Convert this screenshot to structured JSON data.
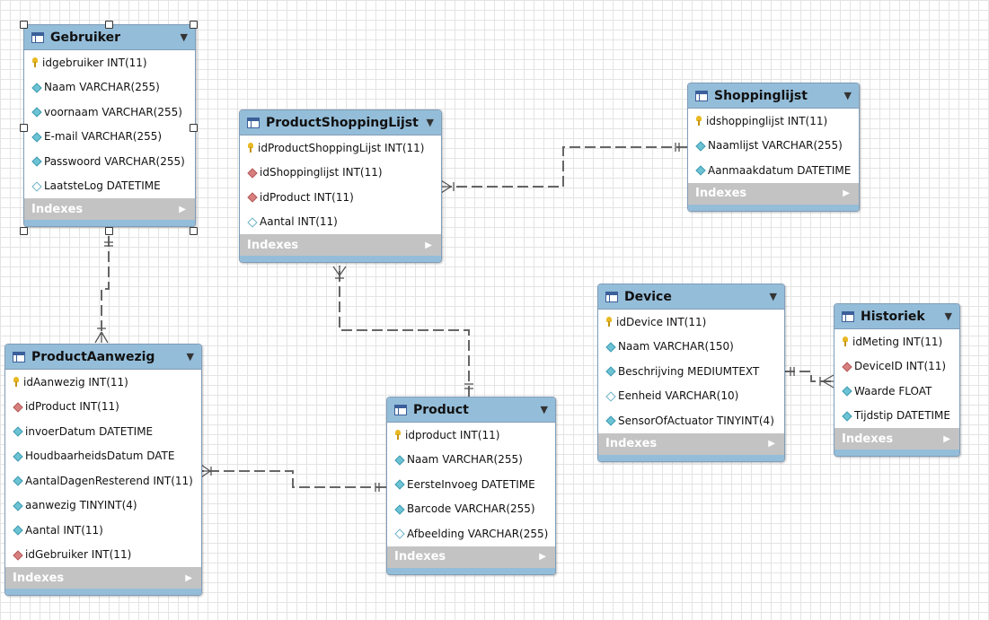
{
  "diagram": {
    "tables": [
      {
        "id": "gebruiker",
        "name": "Gebruiker",
        "columns": [
          {
            "icon": "primary-key-icon",
            "text": "idgebruiker INT(11)"
          },
          {
            "icon": "not-null-column-icon",
            "text": "Naam VARCHAR(255)"
          },
          {
            "icon": "not-null-column-icon",
            "text": "voornaam VARCHAR(255)"
          },
          {
            "icon": "not-null-column-icon",
            "text": "E-mail VARCHAR(255)"
          },
          {
            "icon": "not-null-column-icon",
            "text": "Passwoord VARCHAR(255)"
          },
          {
            "icon": "nullable-column-icon",
            "text": "LaatsteLog DATETIME"
          }
        ],
        "indexes_label": "Indexes",
        "selected": true
      },
      {
        "id": "productshoppinglijst",
        "name": "ProductShoppingLijst",
        "columns": [
          {
            "icon": "primary-key-icon",
            "text": "idProductShoppingLijst INT(11)"
          },
          {
            "icon": "foreign-key-icon",
            "text": "idShoppinglijst INT(11)"
          },
          {
            "icon": "foreign-key-icon",
            "text": "idProduct INT(11)"
          },
          {
            "icon": "nullable-column-icon",
            "text": "Aantal INT(11)"
          }
        ],
        "indexes_label": "Indexes"
      },
      {
        "id": "shoppinglijst",
        "name": "Shoppinglijst",
        "columns": [
          {
            "icon": "primary-key-icon",
            "text": "idshoppinglijst INT(11)"
          },
          {
            "icon": "not-null-column-icon",
            "text": "Naamlijst VARCHAR(255)"
          },
          {
            "icon": "not-null-column-icon",
            "text": "Aanmaakdatum DATETIME"
          }
        ],
        "indexes_label": "Indexes"
      },
      {
        "id": "device",
        "name": "Device",
        "columns": [
          {
            "icon": "primary-key-icon",
            "text": "idDevice INT(11)"
          },
          {
            "icon": "not-null-column-icon",
            "text": "Naam VARCHAR(150)"
          },
          {
            "icon": "not-null-column-icon",
            "text": "Beschrijving MEDIUMTEXT"
          },
          {
            "icon": "nullable-column-icon",
            "text": "Eenheid VARCHAR(10)"
          },
          {
            "icon": "not-null-column-icon",
            "text": "SensorOfActuator TINYINT(4)"
          }
        ],
        "indexes_label": "Indexes"
      },
      {
        "id": "historiek",
        "name": "Historiek",
        "columns": [
          {
            "icon": "primary-key-icon",
            "text": "idMeting INT(11)"
          },
          {
            "icon": "foreign-key-icon",
            "text": "DeviceID INT(11)"
          },
          {
            "icon": "not-null-column-icon",
            "text": "Waarde FLOAT"
          },
          {
            "icon": "not-null-column-icon",
            "text": "Tijdstip DATETIME"
          }
        ],
        "indexes_label": "Indexes"
      },
      {
        "id": "productaanwezig",
        "name": "ProductAanwezig",
        "columns": [
          {
            "icon": "primary-key-icon",
            "text": "idAanwezig INT(11)"
          },
          {
            "icon": "foreign-key-icon",
            "text": "idProduct INT(11)"
          },
          {
            "icon": "not-null-column-icon",
            "text": "invoerDatum DATETIME"
          },
          {
            "icon": "not-null-column-icon",
            "text": "HoudbaarheidsDatum DATE"
          },
          {
            "icon": "not-null-column-icon",
            "text": "AantalDagenResterend INT(11)"
          },
          {
            "icon": "not-null-column-icon",
            "text": "aanwezig TINYINT(4)"
          },
          {
            "icon": "not-null-column-icon",
            "text": "Aantal INT(11)"
          },
          {
            "icon": "foreign-key-icon",
            "text": "idGebruiker INT(11)"
          }
        ],
        "indexes_label": "Indexes"
      },
      {
        "id": "product",
        "name": "Product",
        "columns": [
          {
            "icon": "primary-key-icon",
            "text": "idproduct INT(11)"
          },
          {
            "icon": "not-null-column-icon",
            "text": "Naam VARCHAR(255)"
          },
          {
            "icon": "not-null-column-icon",
            "text": "EersteInvoeg DATETIME"
          },
          {
            "icon": "not-null-column-icon",
            "text": "Barcode VARCHAR(255)"
          },
          {
            "icon": "nullable-column-icon",
            "text": "Afbeelding VARCHAR(255)"
          }
        ],
        "indexes_label": "Indexes"
      }
    ],
    "relationships": [
      {
        "from": "gebruiker",
        "to": "productaanwezig",
        "from_end": "one-mandatory",
        "to_end": "many-mandatory"
      },
      {
        "from": "shoppinglijst",
        "to": "productshoppinglijst",
        "from_end": "one-mandatory",
        "to_end": "many-mandatory"
      },
      {
        "from": "product",
        "to": "productshoppinglijst",
        "from_end": "one-mandatory",
        "to_end": "many-mandatory"
      },
      {
        "from": "product",
        "to": "productaanwezig",
        "from_end": "one-mandatory",
        "to_end": "many-mandatory"
      },
      {
        "from": "device",
        "to": "historiek",
        "from_end": "one-mandatory",
        "to_end": "many-mandatory"
      }
    ],
    "colors": {
      "header": "#94bdd9",
      "indexes_bar": "#c3c3c3",
      "connector": "#666666",
      "grid": "#e4e4e4"
    }
  }
}
